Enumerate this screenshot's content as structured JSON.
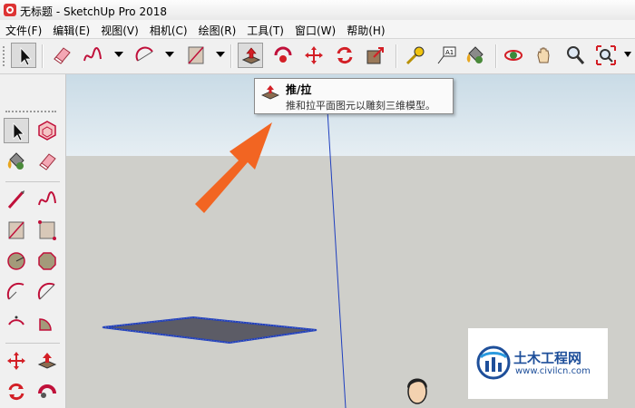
{
  "window": {
    "title": "无标题 - SketchUp Pro 2018"
  },
  "menu": {
    "items": [
      "文件(F)",
      "编辑(E)",
      "视图(V)",
      "相机(C)",
      "绘图(R)",
      "工具(T)",
      "窗口(W)",
      "帮助(H)"
    ]
  },
  "toolbar": {
    "tools": [
      "select-icon",
      "eraser-icon",
      "freehand-icon",
      "arc-icon",
      "rectangle-icon",
      "push-pull-icon",
      "follow-me-icon",
      "move-icon",
      "rotate-icon",
      "scale-icon",
      "tape-measure-icon",
      "text-icon",
      "paint-bucket-icon",
      "orbit-icon",
      "pan-icon",
      "zoom-icon",
      "zoom-extents-icon"
    ],
    "pressed": "push-pull-icon"
  },
  "left_toolbar": {
    "tools": [
      "select-icon",
      "make-component-icon",
      "paint-bucket-icon",
      "eraser-icon",
      "line-icon",
      "freehand-icon",
      "rectangle-icon",
      "rotated-rectangle-icon",
      "circle-icon",
      "polygon-icon",
      "arc-icon",
      "two-point-arc-icon",
      "three-point-arc-icon",
      "pie-icon",
      "move-icon",
      "push-pull-icon",
      "rotate-icon",
      "follow-me-icon"
    ],
    "pressed": "select-icon"
  },
  "tooltip": {
    "title": "推/拉",
    "description": "推和拉平面图元以雕刻三维模型。"
  },
  "watermark": {
    "title": "土木工程网",
    "url": "www.civilcn.com"
  },
  "colors": {
    "arrow": "#f26522",
    "axis_blue": "#1f3fbf",
    "sky": "#c9dbe6",
    "ground": "#cfcfca",
    "watermark_blue": "#1e4f9a"
  }
}
